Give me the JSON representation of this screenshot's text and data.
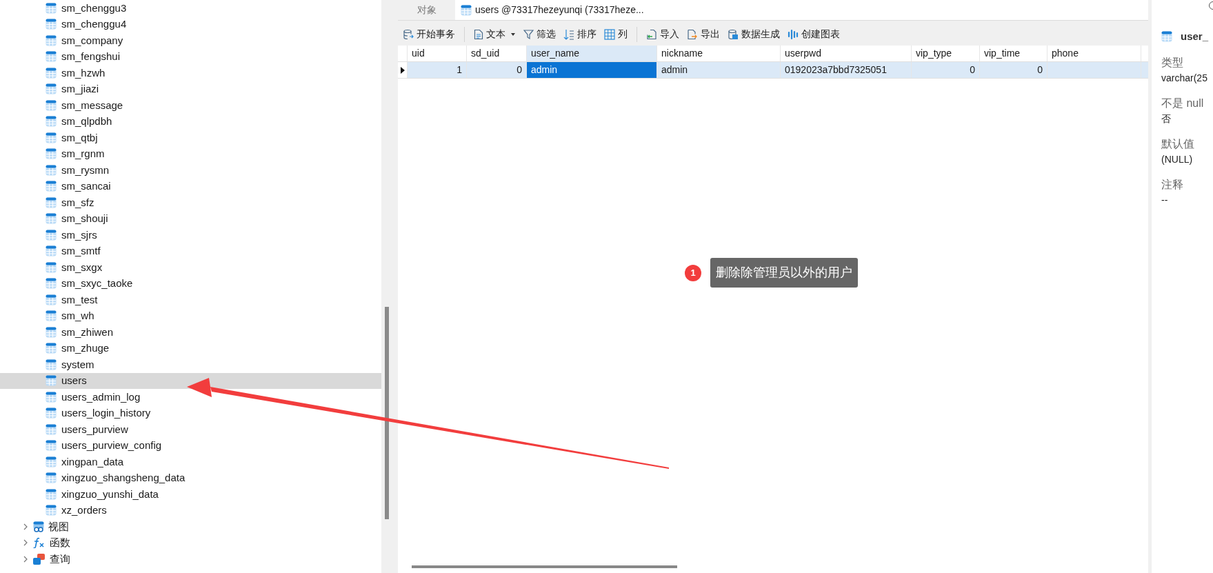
{
  "tree": {
    "tables": [
      {
        "label": "sm_chenggu3",
        "selected": false
      },
      {
        "label": "sm_chenggu4",
        "selected": false
      },
      {
        "label": "sm_company",
        "selected": false
      },
      {
        "label": "sm_fengshui",
        "selected": false
      },
      {
        "label": "sm_hzwh",
        "selected": false
      },
      {
        "label": "sm_jiazi",
        "selected": false
      },
      {
        "label": "sm_message",
        "selected": false
      },
      {
        "label": "sm_qlpdbh",
        "selected": false
      },
      {
        "label": "sm_qtbj",
        "selected": false
      },
      {
        "label": "sm_rgnm",
        "selected": false
      },
      {
        "label": "sm_rysmn",
        "selected": false
      },
      {
        "label": "sm_sancai",
        "selected": false
      },
      {
        "label": "sm_sfz",
        "selected": false
      },
      {
        "label": "sm_shouji",
        "selected": false
      },
      {
        "label": "sm_sjrs",
        "selected": false
      },
      {
        "label": "sm_smtf",
        "selected": false
      },
      {
        "label": "sm_sxgx",
        "selected": false
      },
      {
        "label": "sm_sxyc_taoke",
        "selected": false
      },
      {
        "label": "sm_test",
        "selected": false
      },
      {
        "label": "sm_wh",
        "selected": false
      },
      {
        "label": "sm_zhiwen",
        "selected": false
      },
      {
        "label": "sm_zhuge",
        "selected": false
      },
      {
        "label": "system",
        "selected": false
      },
      {
        "label": "users",
        "selected": true
      },
      {
        "label": "users_admin_log",
        "selected": false
      },
      {
        "label": "users_login_history",
        "selected": false
      },
      {
        "label": "users_purview",
        "selected": false
      },
      {
        "label": "users_purview_config",
        "selected": false
      },
      {
        "label": "xingpan_data",
        "selected": false
      },
      {
        "label": "xingzuo_shangsheng_data",
        "selected": false
      },
      {
        "label": "xingzuo_yunshi_data",
        "selected": false
      },
      {
        "label": "xz_orders",
        "selected": false
      }
    ],
    "groups": [
      {
        "kind": "view",
        "label": "视图",
        "expanded": false
      },
      {
        "kind": "function",
        "label": "函数",
        "expanded": false
      },
      {
        "kind": "query",
        "label": "查询",
        "expanded": false
      }
    ]
  },
  "tabs": [
    {
      "label": "对象",
      "selected": false,
      "kind": "objects"
    },
    {
      "label": "users @73317hezeyunqi (73317heze...",
      "selected": true,
      "kind": "table"
    }
  ],
  "toolbar": [
    {
      "kind": "transaction",
      "label": "开始事务"
    },
    {
      "kind": "separator"
    },
    {
      "kind": "text",
      "label": "文本",
      "dropdown": true
    },
    {
      "kind": "filter",
      "label": "筛选"
    },
    {
      "kind": "sort",
      "label": "排序"
    },
    {
      "kind": "columns",
      "label": "列"
    },
    {
      "kind": "separator"
    },
    {
      "kind": "import",
      "label": "导入"
    },
    {
      "kind": "export",
      "label": "导出"
    },
    {
      "kind": "generate",
      "label": "数据生成"
    },
    {
      "kind": "chart",
      "label": "创建图表"
    }
  ],
  "table": {
    "columns": [
      {
        "label": "uid",
        "kind": "number",
        "selected": false
      },
      {
        "label": "sd_uid",
        "kind": "number",
        "selected": false
      },
      {
        "label": "user_name",
        "kind": "text",
        "selected": true
      },
      {
        "label": "nickname",
        "kind": "text",
        "selected": false
      },
      {
        "label": "userpwd",
        "kind": "text",
        "selected": false
      },
      {
        "label": "vip_type",
        "kind": "number",
        "selected": false
      },
      {
        "label": "vip_time",
        "kind": "number",
        "selected": false
      },
      {
        "label": "phone",
        "kind": "text",
        "selected": false
      }
    ],
    "rows": [
      {
        "selected": true,
        "cells": [
          "1",
          "0",
          "admin",
          "admin",
          "0192023a7bbd7325051",
          "0",
          "0",
          ""
        ]
      }
    ]
  },
  "field_panel": {
    "name": "user_",
    "properties": [
      {
        "label": "类型",
        "value": "varchar(25"
      },
      {
        "label": "不是 null",
        "value": "否"
      },
      {
        "label": "默认值",
        "value": "(NULL)"
      },
      {
        "label": "注释",
        "value": "--"
      }
    ]
  },
  "annotation": {
    "number": "1",
    "text": "删除除管理员以外的用户"
  }
}
